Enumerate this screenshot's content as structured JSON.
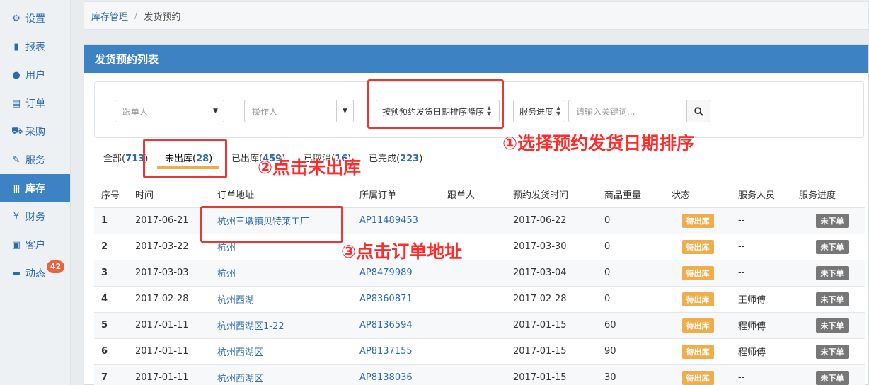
{
  "sidebar": {
    "items": [
      {
        "label": "设置",
        "icon": "⚙"
      },
      {
        "label": "报表",
        "icon": "▮"
      },
      {
        "label": "用户",
        "icon": "●"
      },
      {
        "label": "订单",
        "icon": "▤"
      },
      {
        "label": "采购",
        "icon": "⛟"
      },
      {
        "label": "服务",
        "icon": "✎"
      },
      {
        "label": "库存",
        "icon": "|||"
      },
      {
        "label": "财务",
        "icon": "¥"
      },
      {
        "label": "客户",
        "icon": "▣"
      },
      {
        "label": "动态",
        "icon": "▬"
      }
    ],
    "badge": "42"
  },
  "breadcrumb": {
    "root": "库存管理",
    "separator": "/",
    "current": "发货预约"
  },
  "panel": {
    "title": "发货预约列表"
  },
  "filters": {
    "follower_placeholder": "跟单人",
    "operator_placeholder": "操作人",
    "sort_value": "按预预约发货日期排序降序",
    "progress_value": "服务进度",
    "search_placeholder": "请输入关键词..."
  },
  "tabs": [
    {
      "label": "全部(",
      "count": "713",
      "close": ")"
    },
    {
      "label": "未出库(",
      "count": "28",
      "close": ")"
    },
    {
      "label": "已出库(",
      "count": "459",
      "close": ")"
    },
    {
      "label": "已取消(",
      "count": "16",
      "close": ")"
    },
    {
      "label": "已完成(",
      "count": "223",
      "close": ")"
    }
  ],
  "annotations": {
    "a1": "①选择预约发货日期排序",
    "a2": "②点击未出库",
    "a3": "③点击订单地址"
  },
  "table": {
    "headers": [
      "序号",
      "时间",
      "订单地址",
      "所属订单",
      "跟单人",
      "预约发货时间",
      "商品重量",
      "状态",
      "服务人员",
      "服务进度"
    ],
    "rows": [
      {
        "idx": "1",
        "time": "2017-06-21",
        "addr": "杭州三墩镇贝特莱工厂",
        "order": "AP11489453",
        "follower": "",
        "ship": "2017-06-22",
        "weight": "0",
        "status": "待出库",
        "staff": "--",
        "progress": "未下单"
      },
      {
        "idx": "2",
        "time": "2017-03-22",
        "addr": "杭州",
        "order": "",
        "follower": "",
        "ship": "2017-03-30",
        "weight": "0",
        "status": "待出库",
        "staff": "--",
        "progress": "未下单"
      },
      {
        "idx": "3",
        "time": "2017-03-03",
        "addr": "杭州",
        "order": "AP8479989",
        "follower": "",
        "ship": "2017-03-04",
        "weight": "0",
        "status": "待出库",
        "staff": "--",
        "progress": "未下单"
      },
      {
        "idx": "4",
        "time": "2017-02-28",
        "addr": "杭州西湖",
        "order": "AP8360871",
        "follower": "",
        "ship": "2017-02-28",
        "weight": "0",
        "status": "待出库",
        "staff": "王师傅",
        "progress": "未下单"
      },
      {
        "idx": "5",
        "time": "2017-01-11",
        "addr": "杭州西湖区1-22",
        "order": "AP8136594",
        "follower": "",
        "ship": "2017-01-15",
        "weight": "60",
        "status": "待出库",
        "staff": "程师傅",
        "progress": "未下单"
      },
      {
        "idx": "6",
        "time": "2017-01-11",
        "addr": "杭州西湖区",
        "order": "AP8137155",
        "follower": "",
        "ship": "2017-01-15",
        "weight": "90",
        "status": "待出库",
        "staff": "程师傅",
        "progress": "未下单"
      },
      {
        "idx": "7",
        "time": "2017-01-11",
        "addr": "杭州西湖区",
        "order": "AP8138036",
        "follower": "",
        "ship": "2017-01-15",
        "weight": "30",
        "status": "待出库",
        "staff": "--",
        "progress": "未下单"
      }
    ]
  },
  "colors": {
    "primary": "#3d83c4",
    "status": "#f0ad4e",
    "progress": "#777777",
    "annotation": "#ff2a2a",
    "badge": "#e8643c"
  }
}
